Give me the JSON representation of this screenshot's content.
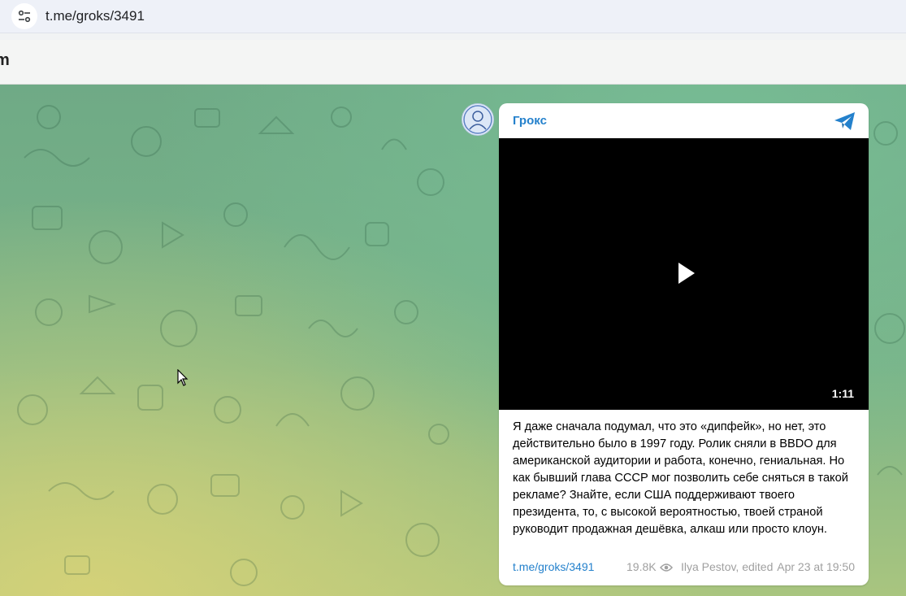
{
  "browser": {
    "url": "t.me/groks/3491",
    "site_settings_icon": "tune-icon"
  },
  "telegram_header": {
    "brand_fragment": "m"
  },
  "message": {
    "channel_name": "Грокс",
    "avatar_icon": "channel-avatar",
    "telegram_icon": "telegram-plane-icon",
    "video": {
      "duration": "1:11",
      "play_icon": "play-icon"
    },
    "text": "Я даже сначала подумал, что это «дипфейк», но нет, это действительно было в 1997 году. Ролик сняли в BBDO для американской аудитории и работа, конечно, гениальная. Но как бывший глава СССР мог позволить себе сняться в такой рекламе? Знайте, если США поддерживают твоего президента, то, с высокой вероятностью, твоей страной руководит продажная дешёвка, алкаш или просто клоун.",
    "link": "t.me/groks/3491",
    "views": "19.8K",
    "views_icon": "eye-icon",
    "author": "Ilya Pestov, edited",
    "date": "Apr 23 at 19:50"
  },
  "colors": {
    "accent": "#2481cc",
    "video_bg": "#000000",
    "bubble_bg": "#ffffff"
  }
}
